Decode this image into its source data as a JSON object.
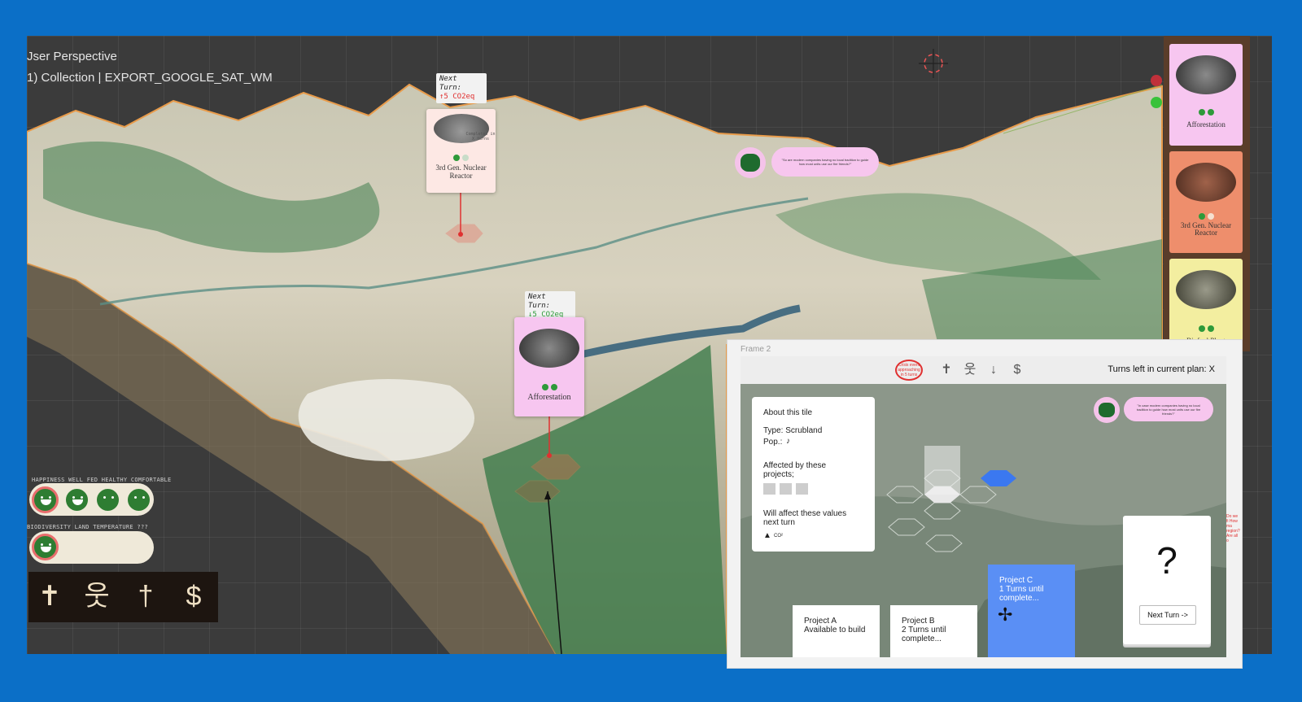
{
  "viewport": {
    "perspective_label": "Jser Perspective",
    "collection_label": "1) Collection | EXPORT_GOOGLE_SAT_WM"
  },
  "map_cards": [
    {
      "turn_label": "Next Turn:",
      "delta": "↑5 CO2eq",
      "delta_color": "#e03030",
      "status": "Completes in X turns",
      "title": "3rd Gen. Nuclear Reactor",
      "card_color": "#fde8e4"
    },
    {
      "turn_label": "Next Turn:",
      "delta": "↓5 CO2eq",
      "delta_color": "#2e9a3a",
      "title": "Afforestation",
      "card_color": "#f7c6f0"
    }
  ],
  "advisor": {
    "quote": "\"So are modern companies having no local tradition to guide how most units use our fire friends?\""
  },
  "hud": {
    "wellbeing_labels": "HAPPINESS   WELL FED   HEALTHY COMFORTABLE",
    "environment_labels": "BIODIVERSITY   LAND   TEMPERATURE   ???",
    "stat_icons": [
      {
        "name": "cross-icon",
        "glyph": "✝"
      },
      {
        "name": "person-icon",
        "glyph": "웃"
      },
      {
        "name": "dagger-icon",
        "glyph": "†"
      },
      {
        "name": "dollar-icon",
        "glyph": "$"
      }
    ]
  },
  "card_strip": [
    {
      "title": "Afforestation",
      "color": "#f7c6f0"
    },
    {
      "title": "3rd Gen. Nuclear Reactor",
      "color": "#ee8e6c"
    },
    {
      "title": "Biofuel Plant",
      "color": "#f3eea0"
    }
  ],
  "status_dots": {
    "red": "#c0303a",
    "green": "#39c23a"
  },
  "frame2": {
    "label": "Frame 2",
    "event_badge": "Crisis event approaching in 5 turns",
    "turns_left": "Turns left in current plan: X",
    "toolbar_icons": [
      {
        "name": "cross-icon",
        "glyph": "✝"
      },
      {
        "name": "person-icon",
        "glyph": "웃"
      },
      {
        "name": "dagger-icon",
        "glyph": "↓"
      },
      {
        "name": "dollar-icon",
        "glyph": "$"
      }
    ],
    "tile_panel": {
      "heading": "About this tile",
      "type": "Type: Scrubland",
      "pop": "Pop.:",
      "affected_by": "Affected by these projects;",
      "will_affect": "Will affect these values next turn",
      "co2": "CO²"
    },
    "advisor_quote": "\"In case modern companies having no local tradition to guide how most units use our fire friends?\"",
    "projects": [
      {
        "line1": "Project A",
        "line2": "Available to build",
        "line3": ""
      },
      {
        "line1": "Project B",
        "line2": "2 Turns until",
        "line3": "complete..."
      },
      {
        "line1": "Project C",
        "line2": "1 Turns until",
        "line3": "complete..."
      }
    ],
    "question_mark": "?",
    "next_turn": "Next Turn ->",
    "side_note_1": "Do we fi How ma region?",
    "side_note_2": "Are all o"
  }
}
